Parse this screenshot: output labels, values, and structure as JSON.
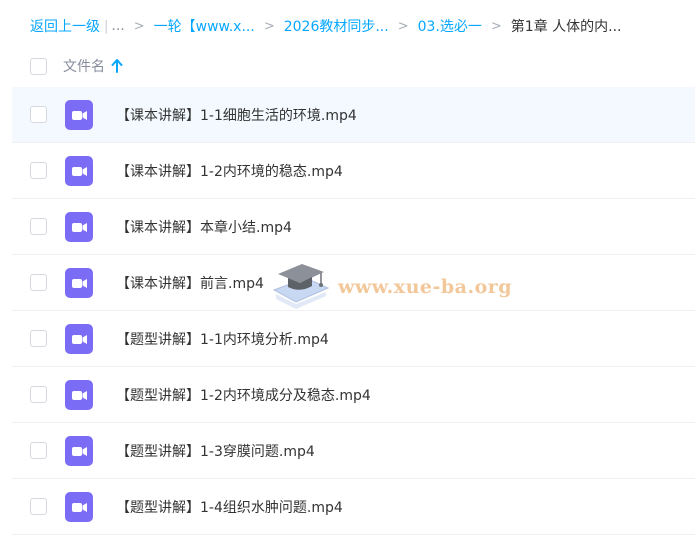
{
  "breadcrumb": {
    "back_label": "返回上一级",
    "separator": "|",
    "ellipsis": "...",
    "items": [
      {
        "label": "一轮【www.x..."
      },
      {
        "label": "2026教材同步..."
      },
      {
        "label": "03.选必一"
      }
    ],
    "current": "第1章 人体的内...",
    "arrow": ">"
  },
  "header": {
    "filename_label": "文件名",
    "sort_icon": "arrow-up-icon"
  },
  "files": [
    {
      "name": "【课本讲解】1-1细胞生活的环境.mp4",
      "icon": "video-file-icon",
      "selected": true
    },
    {
      "name": "【课本讲解】1-2内环境的稳态.mp4",
      "icon": "video-file-icon",
      "selected": false
    },
    {
      "name": "【课本讲解】本章小结.mp4",
      "icon": "video-file-icon",
      "selected": false
    },
    {
      "name": "【课本讲解】前言.mp4",
      "icon": "video-file-icon",
      "selected": false
    },
    {
      "name": "【题型讲解】1-1内环境分析.mp4",
      "icon": "video-file-icon",
      "selected": false
    },
    {
      "name": "【题型讲解】1-2内环境成分及稳态.mp4",
      "icon": "video-file-icon",
      "selected": false
    },
    {
      "name": "【题型讲解】1-3穿膜问题.mp4",
      "icon": "video-file-icon",
      "selected": false
    },
    {
      "name": "【题型讲解】1-4组织水肿问题.mp4",
      "icon": "video-file-icon",
      "selected": false
    }
  ],
  "watermark": {
    "text": "www.xue-ba.org",
    "icon": "graduation-cap-icon"
  },
  "colors": {
    "link": "#06a7ff",
    "video_icon": "#7b6cf6",
    "selected_row": "#f3f9fe",
    "watermark": "#f2c79a"
  }
}
